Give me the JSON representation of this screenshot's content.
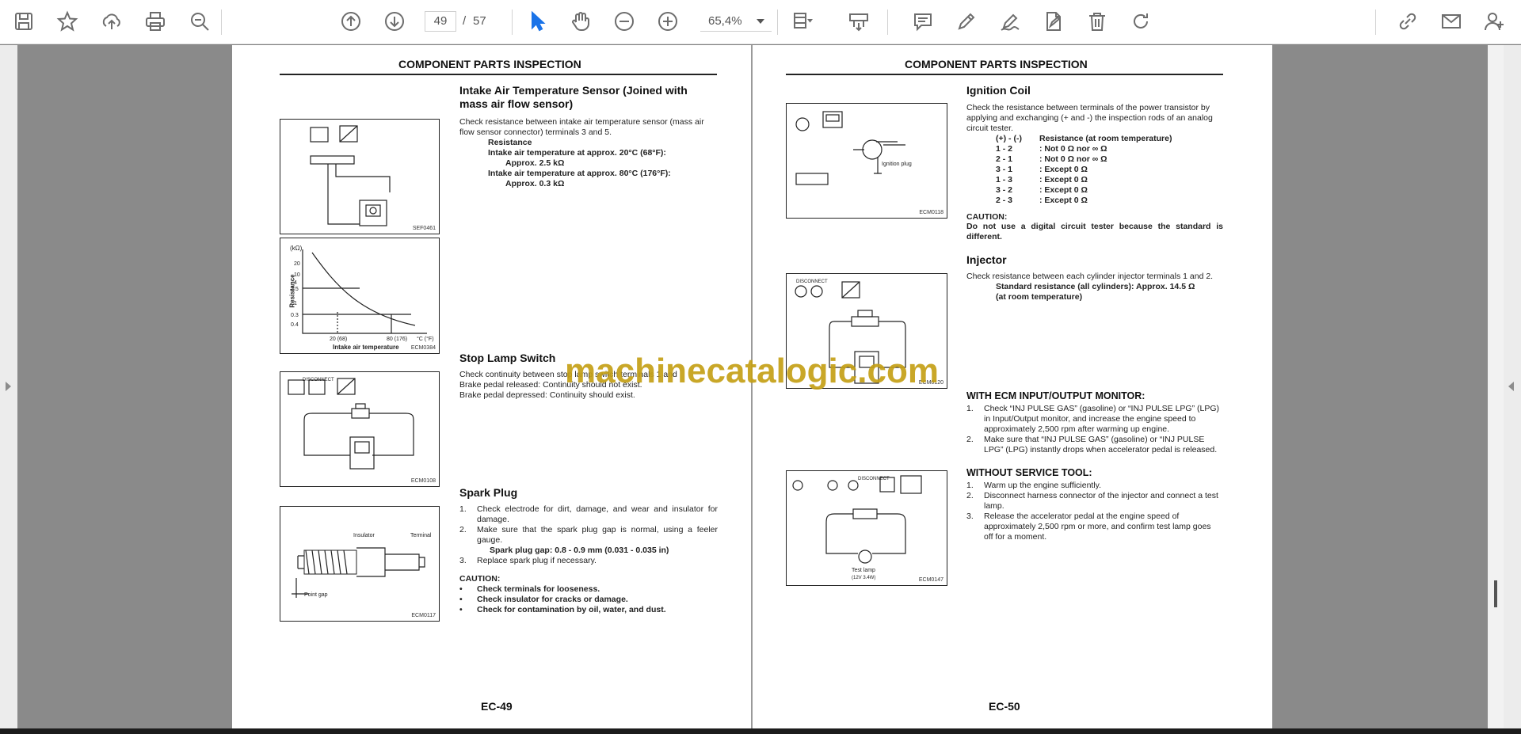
{
  "toolbar": {
    "page_current": "49",
    "page_separator": "/",
    "page_total": "57",
    "zoom": "65,4%",
    "icons": [
      "save-icon",
      "star-icon",
      "upload-icon",
      "print-icon",
      "zoom-search-icon",
      "page-up-icon",
      "page-down-icon",
      "pointer-icon",
      "hand-icon",
      "zoom-out-icon",
      "zoom-in-icon",
      "fit-page-icon",
      "scroll-mode-icon",
      "comment-icon",
      "pen-icon",
      "sign-icon",
      "fill-sign-icon",
      "delete-icon",
      "rotate-icon",
      "share-link-icon",
      "mail-icon",
      "add-user-icon"
    ]
  },
  "watermark": "machinecatalogic.com",
  "page_left": {
    "title": "COMPONENT PARTS INSPECTION",
    "page_number": "EC-49",
    "s1_heading_1": "Intake Air Temperature Sensor (Joined with",
    "s1_heading_2": "mass air flow sensor)",
    "s1_text_1": "Check resistance between intake air temperature sensor (mass air",
    "s1_text_2": "flow sensor connector) terminals 3 and 5.",
    "s1_resistance": "Resistance",
    "s1_line_1": "Intake air temperature at approx. 20°C (68°F):",
    "s1_line_2": "Approx. 2.5 kΩ",
    "s1_line_3": "Intake air temperature at approx. 80°C (176°F):",
    "s1_line_4": "Approx. 0.3 kΩ",
    "fig1_caption": "SEF0461",
    "fig2_caption": "ECM0384",
    "fig2_xlabel": "Intake air temperature",
    "fig2_ylabel": "Resistance",
    "fig2_yunit": "(kΩ)",
    "fig2_y_ticks": [
      "20",
      "10",
      "4",
      "2.5",
      "1",
      "0.3",
      "0.4"
    ],
    "fig2_x_ticks": [
      "20 (68)",
      "80 (176)",
      "°C (°F)"
    ],
    "s2_heading": "Stop Lamp Switch",
    "s2_text_1": "Check continuity between stop lamp switch terminals 1 and",
    "s2_text_2": "Brake pedal released: Continuity should not exist.",
    "s2_text_3": "Brake pedal depressed: Continuity should exist.",
    "fig3_caption": "ECM0108",
    "fig3_label_1": "DISCONNECT",
    "s3_heading": "Spark Plug",
    "s3_items": [
      {
        "num": "1.",
        "text": "Check electrode for dirt, damage, and wear and insulator for damage."
      },
      {
        "num": "2.",
        "text": "Make sure that the spark plug gap is normal, using a feeler gauge."
      },
      {
        "num": "",
        "text": "Spark plug gap: 0.8 - 0.9 mm (0.031 - 0.035 in)"
      },
      {
        "num": "3.",
        "text": "Replace spark plug if necessary."
      }
    ],
    "s3_caution": "CAUTION:",
    "s3_bullets": [
      "Check terminals for looseness.",
      "Check insulator for cracks or damage.",
      "Check for contamination by oil, water, and dust."
    ],
    "fig4_caption": "ECM0117",
    "fig4_label_insulator": "Insulator",
    "fig4_label_terminal": "Terminal",
    "fig4_label_gap": "Point gap"
  },
  "page_right": {
    "title": "COMPONENT PARTS INSPECTION",
    "page_number": "EC-50",
    "s1_heading": "Ignition Coil",
    "s1_text": [
      "Check the resistance between terminals of the power transistor by",
      "applying and exchanging (+ and -) the inspection rods of an analog",
      "circuit tester."
    ],
    "s1_table_head_a": "(+) - (-)",
    "s1_table_head_b": "Resistance (at room temperature)",
    "s1_table": [
      {
        "pair": "1 - 2",
        "value": ": Not 0 Ω nor ∞ Ω"
      },
      {
        "pair": "2 - 1",
        "value": ": Not 0 Ω nor ∞ Ω"
      },
      {
        "pair": "3 - 1",
        "value": ": Except 0 Ω"
      },
      {
        "pair": "1 - 3",
        "value": ": Except 0 Ω"
      },
      {
        "pair": "3 - 2",
        "value": ": Except 0 Ω"
      },
      {
        "pair": "2 - 3",
        "value": ": Except 0 Ω"
      }
    ],
    "s1_caution": "CAUTION:",
    "s1_caution_text_1": "Do not use a digital circuit tester because the standard is",
    "s1_caution_text_2": "different.",
    "fig1_caption": "ECM0118",
    "fig1_label": "Ignition plug",
    "s2_heading": "Injector",
    "s2_text": "Check resistance between each cylinder injector terminals 1 and 2.",
    "s2_std_1": "Standard resistance (all cylinders): Approx. 14.5 Ω",
    "s2_std_2": "(at room temperature)",
    "fig2_caption": "ECM0120",
    "fig2_label": "DISCONNECT",
    "s3_heading": "WITH ECM INPUT/OUTPUT MONITOR:",
    "s3_items": [
      {
        "num": "1.",
        "lines": [
          "Check “INJ PULSE GAS” (gasoline) or “INJ PULSE LPG” (LPG)",
          "in Input/Output monitor, and increase the engine speed to",
          "approximately 2,500 rpm after warming up engine."
        ]
      },
      {
        "num": "2.",
        "lines": [
          "Make sure that “INJ PULSE GAS” (gasoline) or “INJ PULSE",
          "LPG” (LPG) instantly drops when accelerator pedal is released."
        ]
      }
    ],
    "s4_heading": "WITHOUT SERVICE TOOL:",
    "s4_items": [
      {
        "num": "1.",
        "lines": [
          "Warm up the engine sufficiently."
        ]
      },
      {
        "num": "2.",
        "lines": [
          "Disconnect harness connector of the injector and connect a test",
          "lamp."
        ]
      },
      {
        "num": "3.",
        "lines": [
          "Release the accelerator pedal at the engine speed of",
          "approximately 2,500 rpm or more, and confirm test lamp goes",
          "off for a moment."
        ]
      }
    ],
    "fig3_caption": "ECM0147",
    "fig3_label_1": "DISCONNECT",
    "fig3_label_2": "Test lamp",
    "fig3_label_3": "(12V 3.4W)"
  }
}
